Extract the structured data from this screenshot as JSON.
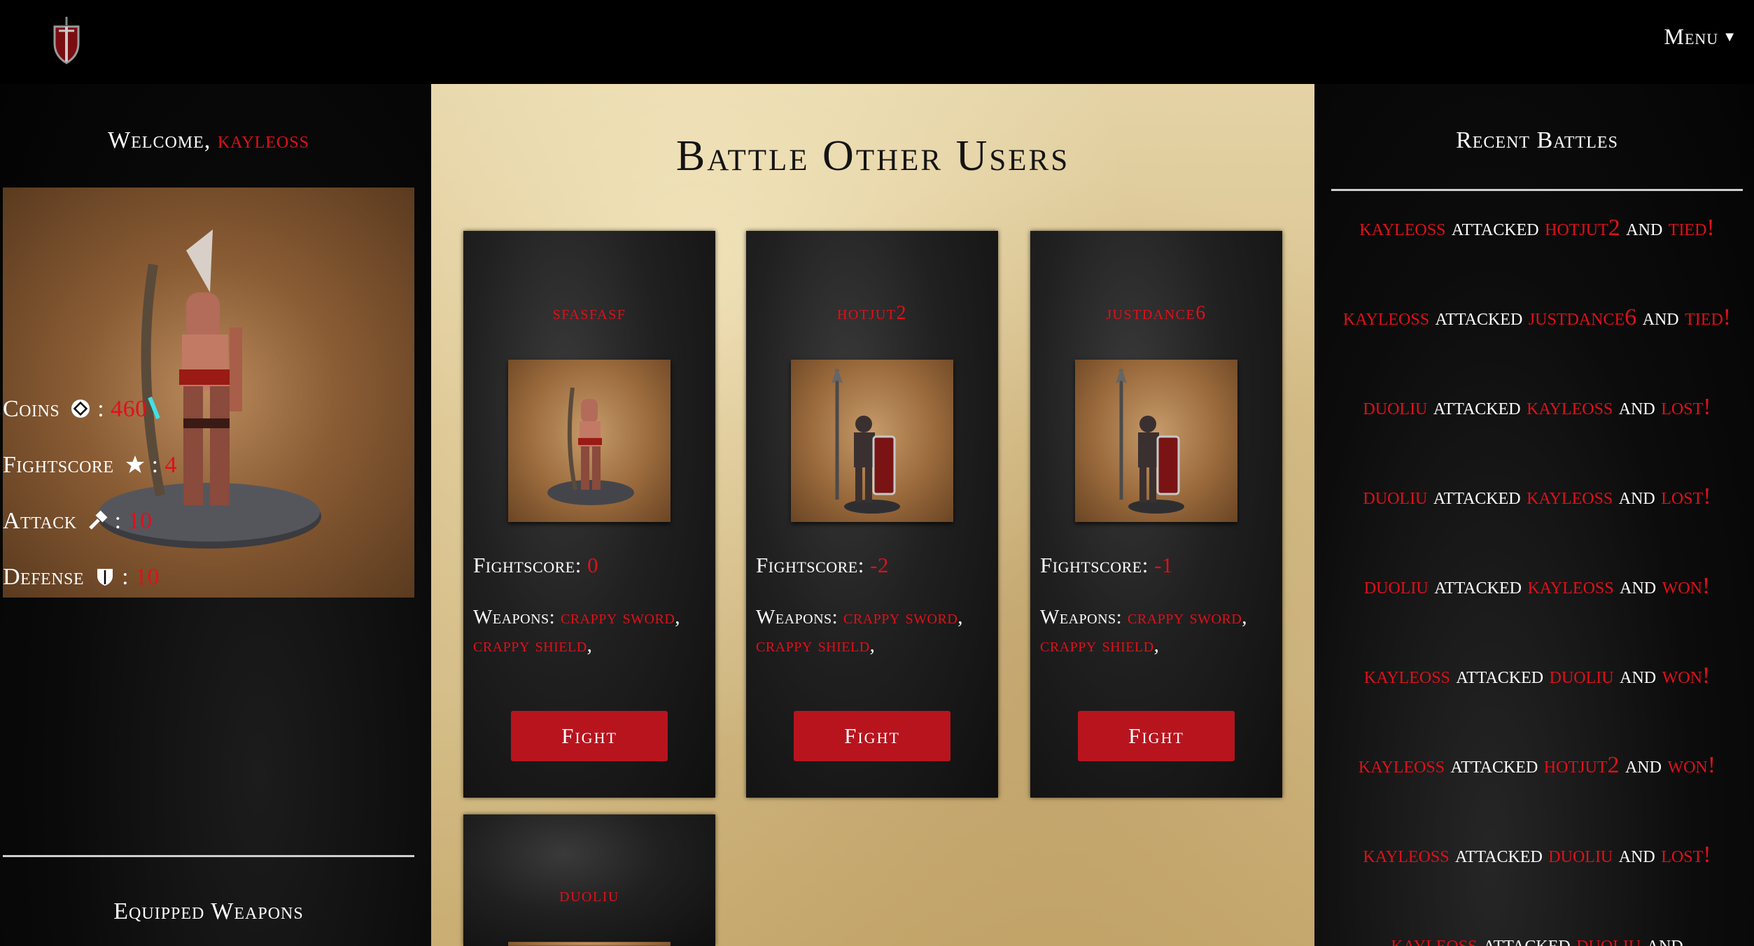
{
  "nav": {
    "menu_label": "Menu"
  },
  "profile": {
    "welcome_prefix": "Welcome, ",
    "username": "kayleoss",
    "coins_label": "Coins",
    "coins": "460",
    "fightscore_label": "Fightscore",
    "fightscore": "4",
    "attack_label": "Attack",
    "attack": "10",
    "defense_label": "Defense",
    "defense": "10",
    "equipped_title": "Equipped Weapons"
  },
  "main": {
    "title": "Battle Other Users",
    "fightscore_label": "Fightscore: ",
    "weapons_label": "Weapons: ",
    "fight_label": "Fight",
    "opponents": [
      {
        "name": "sfasfasf",
        "fightscore": "0",
        "weapon1": "crappy sword",
        "weapon2": "crappy shield"
      },
      {
        "name": "hotjut2",
        "fightscore": "-2",
        "weapon1": "crappy sword",
        "weapon2": "crappy shield"
      },
      {
        "name": "justdance6",
        "fightscore": "-1",
        "weapon1": "crappy sword",
        "weapon2": "crappy shield"
      },
      {
        "name": "duoliu"
      }
    ]
  },
  "recent": {
    "title": "Recent Battles",
    "attacked_word": " attacked ",
    "and_word": " and ",
    "battles": [
      {
        "attacker": "kayleoss",
        "defender": "hotjut2",
        "result": "tied!"
      },
      {
        "attacker": "kayleoss",
        "defender": "justdance6",
        "result": "tied!"
      },
      {
        "attacker": "duoliu",
        "defender": "kayleoss",
        "result": "lost!"
      },
      {
        "attacker": "duoliu",
        "defender": "kayleoss",
        "result": "lost!"
      },
      {
        "attacker": "duoliu",
        "defender": "kayleoss",
        "result": "won!"
      },
      {
        "attacker": "kayleoss",
        "defender": "duoliu",
        "result": "won!"
      },
      {
        "attacker": "kayleoss",
        "defender": "hotjut2",
        "result": "won!"
      },
      {
        "attacker": "kayleoss",
        "defender": "duoliu",
        "result": "lost!"
      },
      {
        "attacker": "kayleoss",
        "defender": "duoliu",
        "result": ""
      }
    ]
  },
  "colors": {
    "accent": "#e0101a",
    "button": "#b8141e",
    "parchment": "#d8c08b"
  },
  "icons": {
    "logo": "shield-sword-logo-icon",
    "coins": "coin-icon",
    "fightscore": "star-icon",
    "attack": "hammer-icon",
    "defense": "shield-icon",
    "menu": "caret-down-icon"
  }
}
